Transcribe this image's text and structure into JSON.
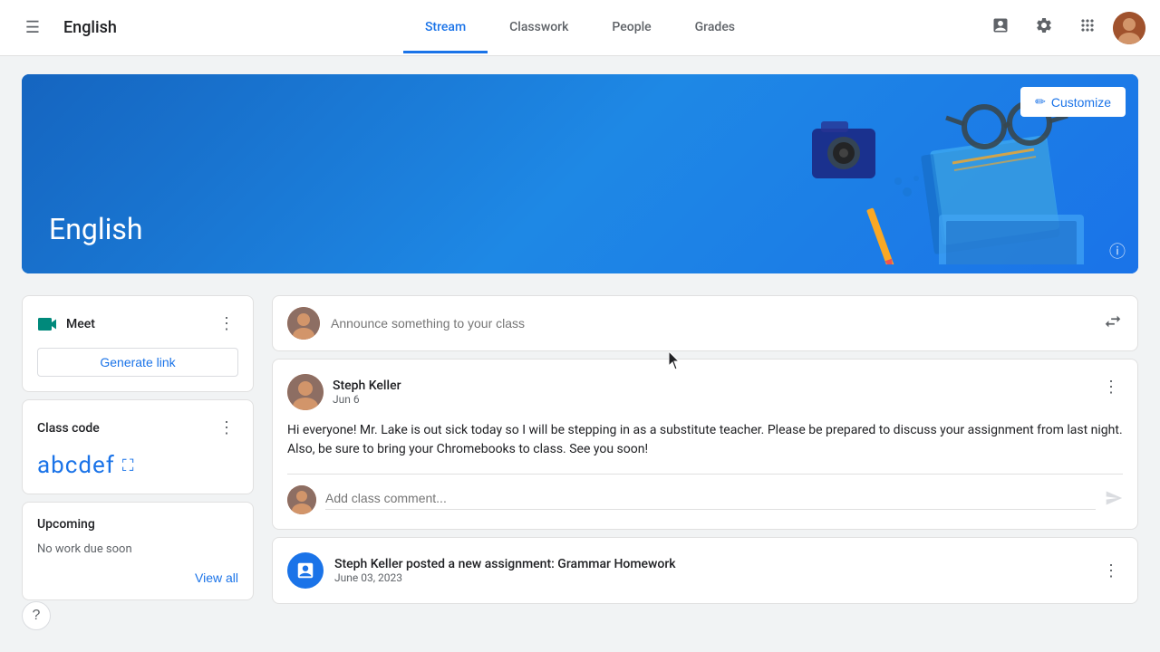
{
  "header": {
    "app_title": "English",
    "nav_tabs": [
      {
        "id": "stream",
        "label": "Stream",
        "active": true
      },
      {
        "id": "classwork",
        "label": "Classwork",
        "active": false
      },
      {
        "id": "people",
        "label": "People",
        "active": false
      },
      {
        "id": "grades",
        "label": "Grades",
        "active": false
      }
    ]
  },
  "banner": {
    "title": "English",
    "customize_label": "Customize"
  },
  "sidebar": {
    "meet": {
      "title": "Meet",
      "generate_link_label": "Generate link"
    },
    "class_code": {
      "title": "Class code",
      "code": "abcdef"
    },
    "upcoming": {
      "title": "Upcoming",
      "no_work_label": "No work due soon",
      "view_all_label": "View all"
    }
  },
  "stream": {
    "announce_placeholder": "Announce something to your class",
    "posts": [
      {
        "author": "Steph Keller",
        "date": "Jun 6",
        "body": "Hi everyone! Mr. Lake is out sick today so I will be stepping in as a substitute teacher. Please be prepared to discuss your assignment from last night. Also, be sure to bring your Chromebooks to class. See you soon!",
        "comment_placeholder": "Add class comment..."
      }
    ],
    "assignments": [
      {
        "title": "Steph Keller posted a new assignment: Grammar Homework",
        "date": "June 03, 2023"
      }
    ]
  },
  "icons": {
    "hamburger": "☰",
    "three_dot": "⋮",
    "customize_pencil": "✏",
    "info": "ⓘ",
    "share": "⇄",
    "send": "➤",
    "expand": "⛶",
    "help": "?"
  },
  "colors": {
    "primary_blue": "#1a73e8",
    "banner_blue": "#1565c0",
    "text_primary": "#202124",
    "text_secondary": "#5f6368"
  }
}
